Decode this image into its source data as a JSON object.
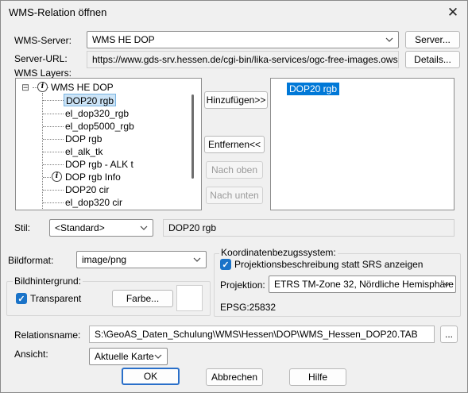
{
  "window": {
    "title": "WMS-Relation öffnen",
    "close_glyph": "✕"
  },
  "server": {
    "label": "WMS-Server:",
    "value": "WMS HE DOP",
    "button": "Server..."
  },
  "server_url": {
    "label": "Server-URL:",
    "value": "https://www.gds-srv.hessen.de/cgi-bin/lika-services/ogc-free-images.ows?langu",
    "button": "Details..."
  },
  "layers": {
    "label": "WMS Layers:",
    "tree_root": "WMS HE DOP",
    "tree_root_toggle": "⊟",
    "items": [
      "DOP20 rgb",
      "el_dop320_rgb",
      "el_dop5000_rgb",
      "DOP rgb",
      "el_alk_tk",
      "DOP rgb - ALK t",
      "DOP rgb Info",
      "DOP20 cir",
      "el_dop320 cir"
    ],
    "add_button": "Hinzufügen>>",
    "remove_button": "Entfernen<<",
    "up_button": "Nach oben",
    "down_button": "Nach unten",
    "selected_items": [
      "DOP20 rgb"
    ]
  },
  "style": {
    "label": "Stil:",
    "value": "<Standard>",
    "layer_name": "DOP20 rgb"
  },
  "bildformat": {
    "label": "Bildformat:",
    "value": "image/png"
  },
  "bildhintergrund": {
    "title": "Bildhintergrund:",
    "checkbox_label": "Transparent",
    "color_button": "Farbe..."
  },
  "crs": {
    "title": "Koordinatenbezugssystem:",
    "checkbox_label": "Projektionsbeschreibung statt SRS anzeigen",
    "projection_label": "Projektion:",
    "projection_value": "ETRS TM-Zone 32, Nördliche Hemisphäre (ET",
    "epsg": "EPSG:25832"
  },
  "relationsname": {
    "label": "Relationsname:",
    "value": "S:\\GeoAS_Daten_Schulung\\WMS\\Hessen\\DOP\\WMS_Hessen_DOP20.TAB",
    "browse_button": "..."
  },
  "ansicht": {
    "label": "Ansicht:",
    "value": "Aktuelle Karte"
  },
  "buttons": {
    "ok": "OK",
    "cancel": "Abbrechen",
    "help": "Hilfe"
  }
}
